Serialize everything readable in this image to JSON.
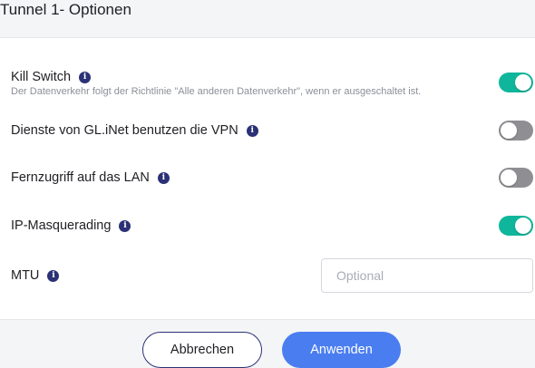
{
  "dialog": {
    "title": "Tunnel 1- Optionen"
  },
  "options": [
    {
      "label": "Kill Switch",
      "description": "Der Datenverkehr folgt der Richtlinie \"Alle anderen Datenverkehr\", wenn er ausgeschaltet ist.",
      "enabled": true
    },
    {
      "label": "Dienste von GL.iNet benutzen die VPN",
      "enabled": false
    },
    {
      "label": "Fernzugriff auf das LAN",
      "enabled": false
    },
    {
      "label": "IP-Masquerading",
      "enabled": true
    }
  ],
  "mtu": {
    "label": "MTU",
    "value": "",
    "placeholder": "Optional"
  },
  "footer": {
    "cancel_label": "Abbrechen",
    "apply_label": "Anwenden"
  },
  "icons": {
    "info": "info-icon",
    "info_glyph": "i"
  },
  "colors": {
    "toggle_on": "#10b69b",
    "toggle_off": "#8e8e93",
    "primary_button": "#4a7df0",
    "cancel_border": "#2b3175",
    "info_icon": "#2b3175"
  }
}
